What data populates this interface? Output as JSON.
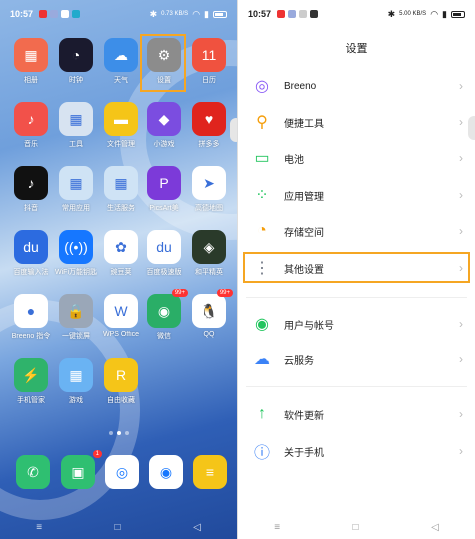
{
  "left": {
    "status": {
      "time": "10:57",
      "right_text": "0.73 KB/S"
    },
    "apps": [
      {
        "label": "相册",
        "color": "#f26b4e",
        "glyph": "▦"
      },
      {
        "label": "时钟",
        "color": "#1a1a2e",
        "glyph": "◔"
      },
      {
        "label": "天气",
        "color": "#3d8ee8",
        "glyph": "☁"
      },
      {
        "label": "设置",
        "color": "#8c8c8c",
        "glyph": "⚙"
      },
      {
        "label": "日历",
        "color": "#f0523f",
        "glyph": "11"
      },
      {
        "label": "音乐",
        "color": "#f2514a",
        "glyph": "♪"
      },
      {
        "label": "工具",
        "color": "#d7e3f1",
        "glyph": "▦"
      },
      {
        "label": "文件管理",
        "color": "#f5c518",
        "glyph": "▬"
      },
      {
        "label": "小游戏",
        "color": "#7b4de0",
        "glyph": "◆"
      },
      {
        "label": "拼多多",
        "color": "#e0241d",
        "glyph": "♥"
      },
      {
        "label": "抖音",
        "color": "#111111",
        "glyph": "♪"
      },
      {
        "label": "常用应用",
        "color": "#cfe3f5",
        "glyph": "▦"
      },
      {
        "label": "生活服务",
        "color": "#cfe3f5",
        "glyph": "▦"
      },
      {
        "label": "PicsArt美",
        "color": "#7c3ad9",
        "glyph": "P"
      },
      {
        "label": "高德地图",
        "color": "#ffffff",
        "glyph": "➤"
      },
      {
        "label": "百度输入法",
        "color": "#2c6be0",
        "glyph": "du"
      },
      {
        "label": "WiFi万能钥匙",
        "color": "#1677ff",
        "glyph": "((•))"
      },
      {
        "label": "豌豆荚",
        "color": "#ffffff",
        "glyph": "✿"
      },
      {
        "label": "百度极速版",
        "color": "#ffffff",
        "glyph": "du"
      },
      {
        "label": "和平精英",
        "color": "#2a3a2a",
        "glyph": "◈"
      },
      {
        "label": "Breeno 指令",
        "color": "#ffffff",
        "glyph": "●"
      },
      {
        "label": "一键锁屏",
        "color": "#9aa7b8",
        "glyph": "🔒"
      },
      {
        "label": "WPS Office",
        "color": "#ffffff",
        "glyph": "W"
      },
      {
        "label": "微信",
        "color": "#2aae67",
        "glyph": "◉",
        "badge": "99+"
      },
      {
        "label": "QQ",
        "color": "#ffffff",
        "glyph": "🐧",
        "badge": "99+"
      },
      {
        "label": "手机管家",
        "color": "#2fb36b",
        "glyph": "⚡"
      },
      {
        "label": "游戏",
        "color": "#6ab3f3",
        "glyph": "▦"
      },
      {
        "label": "自由收藏",
        "color": "#f5c518",
        "glyph": "R"
      }
    ],
    "dock": [
      {
        "label": "",
        "color": "#2fbf71",
        "glyph": "✆"
      },
      {
        "label": "",
        "color": "#2fbf71",
        "glyph": "▣",
        "badge": "1"
      },
      {
        "label": "",
        "color": "#ffffff",
        "glyph": "◎"
      },
      {
        "label": "",
        "color": "#ffffff",
        "glyph": "◉"
      },
      {
        "label": "",
        "color": "#f5c518",
        "glyph": "≡"
      }
    ]
  },
  "right": {
    "status": {
      "time": "10:57",
      "right_text": "5.00 KB/S"
    },
    "title": "设置",
    "items": [
      {
        "label": "Breeno",
        "icon_color": "#8b5cf6",
        "icon": "◎"
      },
      {
        "label": "便捷工具",
        "icon_color": "#f59e0b",
        "icon": "⚲"
      },
      {
        "label": "电池",
        "icon_color": "#22c55e",
        "icon": "▭"
      },
      {
        "label": "应用管理",
        "icon_color": "#22c55e",
        "icon": "⁘"
      },
      {
        "label": "存储空间",
        "icon_color": "#f59e0b",
        "icon": "◔"
      },
      {
        "label": "其他设置",
        "icon_color": "#6b7280",
        "icon": "⋮"
      },
      {
        "label": "用户与帐号",
        "icon_color": "#22c55e",
        "icon": "◉"
      },
      {
        "label": "云服务",
        "icon_color": "#3b82f6",
        "icon": "☁"
      },
      {
        "label": "软件更新",
        "icon_color": "#22c55e",
        "icon": "↑"
      },
      {
        "label": "关于手机",
        "icon_color": "#3b82f6",
        "icon": "ⓘ"
      }
    ]
  },
  "nav": {
    "menu": "≡",
    "home": "□",
    "back": "◁"
  },
  "colors": {
    "highlight": "#f5a623"
  }
}
